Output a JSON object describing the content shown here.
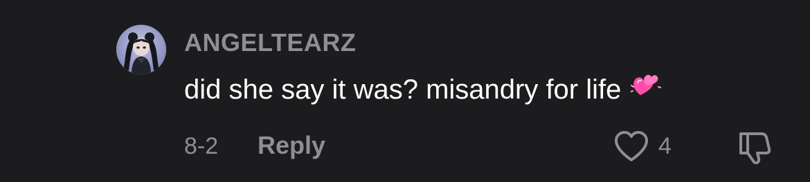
{
  "comment": {
    "username": "ANGELTEARZ",
    "text": "did she say it was? misandry for life",
    "emoji": "two-hearts-emoji",
    "date": "8-2",
    "reply_label": "Reply",
    "like_count": "4",
    "like_icon": "heart-outline-icon",
    "dislike_icon": "thumbs-down-icon"
  },
  "colors": {
    "background": "#1c1c1e",
    "text": "#ffffff",
    "muted": "#8e8e93",
    "emoji_pink": "#ff4fa8"
  }
}
